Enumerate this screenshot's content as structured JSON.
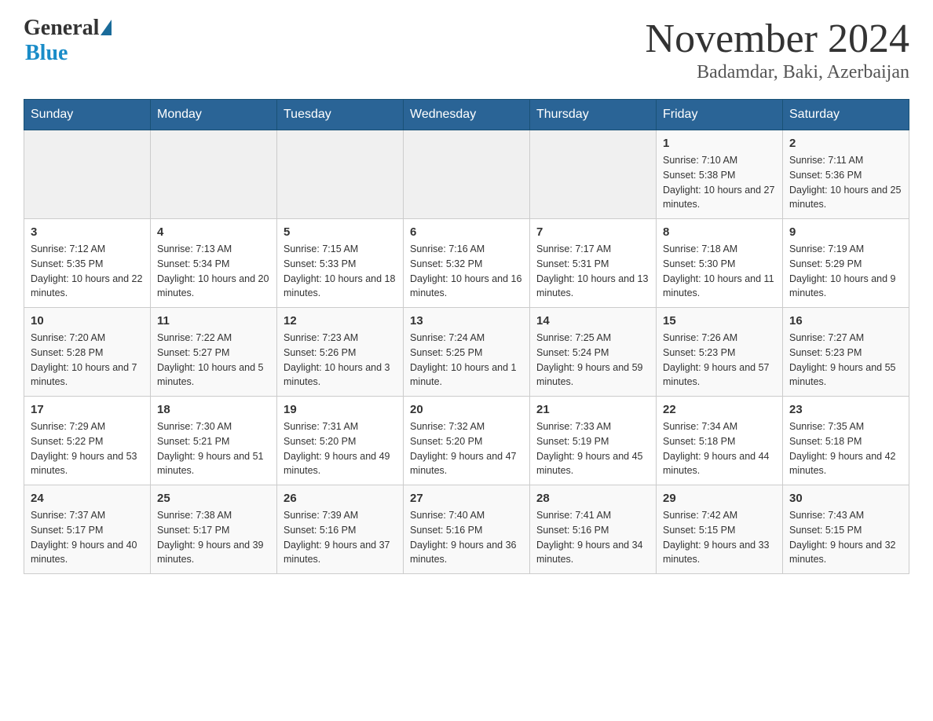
{
  "header": {
    "logo": {
      "general_text": "General",
      "blue_text": "Blue"
    },
    "title": "November 2024",
    "location": "Badamdar, Baki, Azerbaijan"
  },
  "calendar": {
    "days_of_week": [
      "Sunday",
      "Monday",
      "Tuesday",
      "Wednesday",
      "Thursday",
      "Friday",
      "Saturday"
    ],
    "weeks": [
      {
        "days": [
          {
            "number": "",
            "info": "",
            "empty": true
          },
          {
            "number": "",
            "info": "",
            "empty": true
          },
          {
            "number": "",
            "info": "",
            "empty": true
          },
          {
            "number": "",
            "info": "",
            "empty": true
          },
          {
            "number": "",
            "info": "",
            "empty": true
          },
          {
            "number": "1",
            "info": "Sunrise: 7:10 AM\nSunset: 5:38 PM\nDaylight: 10 hours and 27 minutes.",
            "empty": false
          },
          {
            "number": "2",
            "info": "Sunrise: 7:11 AM\nSunset: 5:36 PM\nDaylight: 10 hours and 25 minutes.",
            "empty": false
          }
        ]
      },
      {
        "days": [
          {
            "number": "3",
            "info": "Sunrise: 7:12 AM\nSunset: 5:35 PM\nDaylight: 10 hours and 22 minutes.",
            "empty": false
          },
          {
            "number": "4",
            "info": "Sunrise: 7:13 AM\nSunset: 5:34 PM\nDaylight: 10 hours and 20 minutes.",
            "empty": false
          },
          {
            "number": "5",
            "info": "Sunrise: 7:15 AM\nSunset: 5:33 PM\nDaylight: 10 hours and 18 minutes.",
            "empty": false
          },
          {
            "number": "6",
            "info": "Sunrise: 7:16 AM\nSunset: 5:32 PM\nDaylight: 10 hours and 16 minutes.",
            "empty": false
          },
          {
            "number": "7",
            "info": "Sunrise: 7:17 AM\nSunset: 5:31 PM\nDaylight: 10 hours and 13 minutes.",
            "empty": false
          },
          {
            "number": "8",
            "info": "Sunrise: 7:18 AM\nSunset: 5:30 PM\nDaylight: 10 hours and 11 minutes.",
            "empty": false
          },
          {
            "number": "9",
            "info": "Sunrise: 7:19 AM\nSunset: 5:29 PM\nDaylight: 10 hours and 9 minutes.",
            "empty": false
          }
        ]
      },
      {
        "days": [
          {
            "number": "10",
            "info": "Sunrise: 7:20 AM\nSunset: 5:28 PM\nDaylight: 10 hours and 7 minutes.",
            "empty": false
          },
          {
            "number": "11",
            "info": "Sunrise: 7:22 AM\nSunset: 5:27 PM\nDaylight: 10 hours and 5 minutes.",
            "empty": false
          },
          {
            "number": "12",
            "info": "Sunrise: 7:23 AM\nSunset: 5:26 PM\nDaylight: 10 hours and 3 minutes.",
            "empty": false
          },
          {
            "number": "13",
            "info": "Sunrise: 7:24 AM\nSunset: 5:25 PM\nDaylight: 10 hours and 1 minute.",
            "empty": false
          },
          {
            "number": "14",
            "info": "Sunrise: 7:25 AM\nSunset: 5:24 PM\nDaylight: 9 hours and 59 minutes.",
            "empty": false
          },
          {
            "number": "15",
            "info": "Sunrise: 7:26 AM\nSunset: 5:23 PM\nDaylight: 9 hours and 57 minutes.",
            "empty": false
          },
          {
            "number": "16",
            "info": "Sunrise: 7:27 AM\nSunset: 5:23 PM\nDaylight: 9 hours and 55 minutes.",
            "empty": false
          }
        ]
      },
      {
        "days": [
          {
            "number": "17",
            "info": "Sunrise: 7:29 AM\nSunset: 5:22 PM\nDaylight: 9 hours and 53 minutes.",
            "empty": false
          },
          {
            "number": "18",
            "info": "Sunrise: 7:30 AM\nSunset: 5:21 PM\nDaylight: 9 hours and 51 minutes.",
            "empty": false
          },
          {
            "number": "19",
            "info": "Sunrise: 7:31 AM\nSunset: 5:20 PM\nDaylight: 9 hours and 49 minutes.",
            "empty": false
          },
          {
            "number": "20",
            "info": "Sunrise: 7:32 AM\nSunset: 5:20 PM\nDaylight: 9 hours and 47 minutes.",
            "empty": false
          },
          {
            "number": "21",
            "info": "Sunrise: 7:33 AM\nSunset: 5:19 PM\nDaylight: 9 hours and 45 minutes.",
            "empty": false
          },
          {
            "number": "22",
            "info": "Sunrise: 7:34 AM\nSunset: 5:18 PM\nDaylight: 9 hours and 44 minutes.",
            "empty": false
          },
          {
            "number": "23",
            "info": "Sunrise: 7:35 AM\nSunset: 5:18 PM\nDaylight: 9 hours and 42 minutes.",
            "empty": false
          }
        ]
      },
      {
        "days": [
          {
            "number": "24",
            "info": "Sunrise: 7:37 AM\nSunset: 5:17 PM\nDaylight: 9 hours and 40 minutes.",
            "empty": false
          },
          {
            "number": "25",
            "info": "Sunrise: 7:38 AM\nSunset: 5:17 PM\nDaylight: 9 hours and 39 minutes.",
            "empty": false
          },
          {
            "number": "26",
            "info": "Sunrise: 7:39 AM\nSunset: 5:16 PM\nDaylight: 9 hours and 37 minutes.",
            "empty": false
          },
          {
            "number": "27",
            "info": "Sunrise: 7:40 AM\nSunset: 5:16 PM\nDaylight: 9 hours and 36 minutes.",
            "empty": false
          },
          {
            "number": "28",
            "info": "Sunrise: 7:41 AM\nSunset: 5:16 PM\nDaylight: 9 hours and 34 minutes.",
            "empty": false
          },
          {
            "number": "29",
            "info": "Sunrise: 7:42 AM\nSunset: 5:15 PM\nDaylight: 9 hours and 33 minutes.",
            "empty": false
          },
          {
            "number": "30",
            "info": "Sunrise: 7:43 AM\nSunset: 5:15 PM\nDaylight: 9 hours and 32 minutes.",
            "empty": false
          }
        ]
      }
    ]
  }
}
